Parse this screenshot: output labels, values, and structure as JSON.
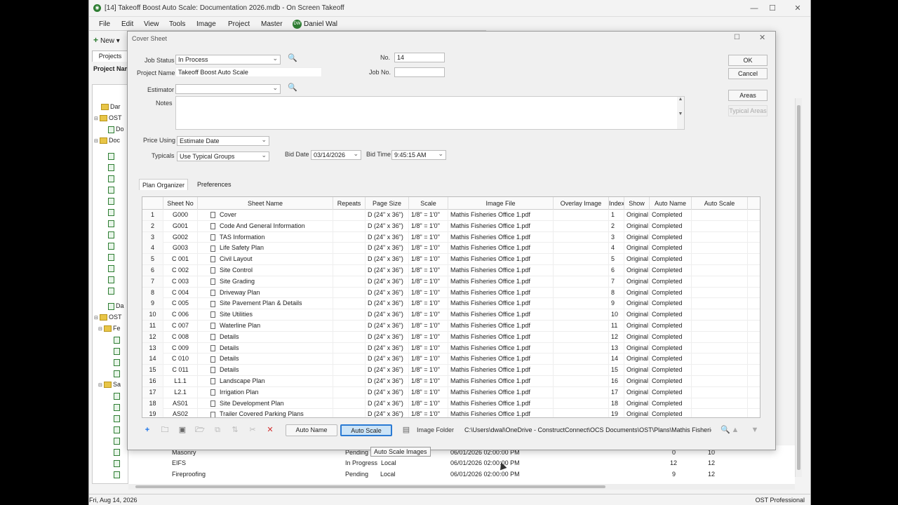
{
  "app": {
    "title": "[14] Takeoff Boost Auto Scale: Documentation 2026.mdb - On Screen Takeoff",
    "menu": [
      "File",
      "Edit",
      "View",
      "Tools",
      "Image",
      "Project",
      "Master"
    ],
    "user_initials": "DW",
    "user_name": "Daniel Wal",
    "new_label": "New",
    "projects_tab": "Projects",
    "project_name_label": "Project Name",
    "tree_items": [
      "Dar",
      "OST",
      "Do",
      "Doc",
      "Da",
      "OST",
      "Fe",
      "Sa"
    ],
    "background_rows": [
      {
        "name": "Masonry",
        "status": "Pending",
        "loc": "",
        "date": "06/01/2026 02:00:00 PM",
        "a": "0",
        "b": "10"
      },
      {
        "name": "EIFS",
        "status": "In Progress",
        "loc": "Local",
        "date": "06/01/2026 02:00:00 PM",
        "a": "12",
        "b": "12"
      },
      {
        "name": "Fireproofing",
        "status": "Pending",
        "loc": "Local",
        "date": "06/01/2026 02:00:00 PM",
        "a": "9",
        "b": "12"
      }
    ],
    "status_left": "Fri, Aug 14, 2026",
    "status_right": "OST Professional"
  },
  "dialog": {
    "title": "Cover Sheet",
    "job_status_label": "Job Status",
    "job_status_value": "In Process",
    "project_name_label": "Project Name",
    "project_name_value": "Takeoff Boost Auto Scale",
    "estimator_label": "Estimator",
    "estimator_value": "",
    "notes_label": "Notes",
    "no_label": "No.",
    "no_value": "14",
    "job_no_label": "Job No.",
    "job_no_value": "",
    "price_using_label": "Price Using",
    "price_using_value": "Estimate Date",
    "typicals_label": "Typicals",
    "typicals_value": "Use Typical Groups",
    "bid_date_label": "Bid Date",
    "bid_date_value": "03/14/2026",
    "bid_time_label": "Bid Time",
    "bid_time_value": "9:45:15 AM",
    "ok_label": "OK",
    "cancel_label": "Cancel",
    "areas_label": "Areas",
    "typical_areas_label": "Typical Areas",
    "tabs": [
      "Plan Organizer",
      "Preferences"
    ],
    "columns": [
      "Sheet No",
      "Sheet Name",
      "Repeats",
      "Page Size",
      "Scale",
      "Image File",
      "Overlay Image",
      "Index",
      "Show",
      "Auto Name",
      "Auto Scale"
    ],
    "rows": [
      {
        "n": "1",
        "sheet": "G000",
        "name": "Cover",
        "size": "D (24\" x 36\")",
        "scale": "1/8\" = 1'0\"",
        "file": "Mathis Fisheries Office 1.pdf",
        "index": "1",
        "show": "Original",
        "auto": "Completed"
      },
      {
        "n": "2",
        "sheet": "G001",
        "name": "Code And General Information",
        "size": "D (24\" x 36\")",
        "scale": "1/8\" = 1'0\"",
        "file": "Mathis Fisheries Office 1.pdf",
        "index": "2",
        "show": "Original",
        "auto": "Completed"
      },
      {
        "n": "3",
        "sheet": "G002",
        "name": "TAS Information",
        "size": "D (24\" x 36\")",
        "scale": "1/8\" = 1'0\"",
        "file": "Mathis Fisheries Office 1.pdf",
        "index": "3",
        "show": "Original",
        "auto": "Completed"
      },
      {
        "n": "4",
        "sheet": "G003",
        "name": "Life Safety Plan",
        "size": "D (24\" x 36\")",
        "scale": "1/8\" = 1'0\"",
        "file": "Mathis Fisheries Office 1.pdf",
        "index": "4",
        "show": "Original",
        "auto": "Completed"
      },
      {
        "n": "5",
        "sheet": "C 001",
        "name": "Civil Layout",
        "size": "D (24\" x 36\")",
        "scale": "1/8\" = 1'0\"",
        "file": "Mathis Fisheries Office 1.pdf",
        "index": "5",
        "show": "Original",
        "auto": "Completed"
      },
      {
        "n": "6",
        "sheet": "C 002",
        "name": "Site Control",
        "size": "D (24\" x 36\")",
        "scale": "1/8\" = 1'0\"",
        "file": "Mathis Fisheries Office 1.pdf",
        "index": "6",
        "show": "Original",
        "auto": "Completed"
      },
      {
        "n": "7",
        "sheet": "C 003",
        "name": "Site Grading",
        "size": "D (24\" x 36\")",
        "scale": "1/8\" = 1'0\"",
        "file": "Mathis Fisheries Office 1.pdf",
        "index": "7",
        "show": "Original",
        "auto": "Completed"
      },
      {
        "n": "8",
        "sheet": "C 004",
        "name": "Driveway Plan",
        "size": "D (24\" x 36\")",
        "scale": "1/8\" = 1'0\"",
        "file": "Mathis Fisheries Office 1.pdf",
        "index": "8",
        "show": "Original",
        "auto": "Completed"
      },
      {
        "n": "9",
        "sheet": "C 005",
        "name": "Site Pavement Plan & Details",
        "size": "D (24\" x 36\")",
        "scale": "1/8\" = 1'0\"",
        "file": "Mathis Fisheries Office 1.pdf",
        "index": "9",
        "show": "Original",
        "auto": "Completed"
      },
      {
        "n": "10",
        "sheet": "C 006",
        "name": "Site Utilities",
        "size": "D (24\" x 36\")",
        "scale": "1/8\" = 1'0\"",
        "file": "Mathis Fisheries Office 1.pdf",
        "index": "10",
        "show": "Original",
        "auto": "Completed"
      },
      {
        "n": "11",
        "sheet": "C 007",
        "name": "Waterline Plan",
        "size": "D (24\" x 36\")",
        "scale": "1/8\" = 1'0\"",
        "file": "Mathis Fisheries Office 1.pdf",
        "index": "11",
        "show": "Original",
        "auto": "Completed"
      },
      {
        "n": "12",
        "sheet": "C 008",
        "name": "Details",
        "size": "D (24\" x 36\")",
        "scale": "1/8\" = 1'0\"",
        "file": "Mathis Fisheries Office 1.pdf",
        "index": "12",
        "show": "Original",
        "auto": "Completed"
      },
      {
        "n": "13",
        "sheet": "C 009",
        "name": "Details",
        "size": "D (24\" x 36\")",
        "scale": "1/8\" = 1'0\"",
        "file": "Mathis Fisheries Office 1.pdf",
        "index": "13",
        "show": "Original",
        "auto": "Completed"
      },
      {
        "n": "14",
        "sheet": "C 010",
        "name": "Details",
        "size": "D (24\" x 36\")",
        "scale": "1/8\" = 1'0\"",
        "file": "Mathis Fisheries Office 1.pdf",
        "index": "14",
        "show": "Original",
        "auto": "Completed"
      },
      {
        "n": "15",
        "sheet": "C 011",
        "name": "Details",
        "size": "D (24\" x 36\")",
        "scale": "1/8\" = 1'0\"",
        "file": "Mathis Fisheries Office 1.pdf",
        "index": "15",
        "show": "Original",
        "auto": "Completed"
      },
      {
        "n": "16",
        "sheet": "L1.1",
        "name": "Landscape Plan",
        "size": "D (24\" x 36\")",
        "scale": "1/8\" = 1'0\"",
        "file": "Mathis Fisheries Office 1.pdf",
        "index": "16",
        "show": "Original",
        "auto": "Completed"
      },
      {
        "n": "17",
        "sheet": "L2.1",
        "name": "Irrigation Plan",
        "size": "D (24\" x 36\")",
        "scale": "1/8\" = 1'0\"",
        "file": "Mathis Fisheries Office 1.pdf",
        "index": "17",
        "show": "Original",
        "auto": "Completed"
      },
      {
        "n": "18",
        "sheet": "AS01",
        "name": "Site Development Plan",
        "size": "D (24\" x 36\")",
        "scale": "1/8\" = 1'0\"",
        "file": "Mathis Fisheries Office 1.pdf",
        "index": "18",
        "show": "Original",
        "auto": "Completed"
      },
      {
        "n": "19",
        "sheet": "AS02",
        "name": "Trailer Covered Parking Plans",
        "size": "D (24\" x 36\")",
        "scale": "1/8\" = 1'0\"",
        "file": "Mathis Fisheries Office 1.pdf",
        "index": "19",
        "show": "Original",
        "auto": "Completed"
      }
    ],
    "auto_name_label": "Auto Name",
    "auto_scale_label": "Auto Scale",
    "image_folder_label": "Image Folder",
    "path_value": "C:\\Users\\dwal\\OneDrive - ConstructConnect\\OCS Documents\\OST\\Plans\\Mathis Fisheries",
    "tooltip": "Auto Scale Images"
  }
}
